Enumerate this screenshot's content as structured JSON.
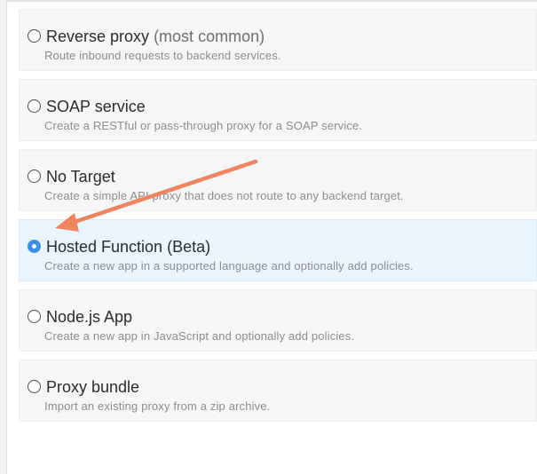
{
  "options": [
    {
      "title": "Reverse proxy",
      "hint": "(most common)",
      "description": "Route inbound requests to backend services.",
      "selected": false
    },
    {
      "title": "SOAP service",
      "hint": "",
      "description": "Create a RESTful or pass-through proxy for a SOAP service.",
      "selected": false
    },
    {
      "title": "No Target",
      "hint": "",
      "description": "Create a simple API proxy that does not route to any backend target.",
      "selected": false
    },
    {
      "title": "Hosted Function (Beta)",
      "hint": "",
      "description": "Create a new app in a supported language and optionally add policies.",
      "selected": true
    },
    {
      "title": "Node.js App",
      "hint": "",
      "description": "Create a new app in JavaScript and optionally add policies.",
      "selected": false
    },
    {
      "title": "Proxy bundle",
      "hint": "",
      "description": "Import an existing proxy from a zip archive.",
      "selected": false
    }
  ],
  "colors": {
    "accent": "#3a8ee6",
    "selected_background": "#eaf4fd",
    "annotation_arrow": "#f0845f"
  },
  "annotation": {
    "icon": "arrow-icon",
    "points_to": "Hosted Function (Beta)"
  }
}
